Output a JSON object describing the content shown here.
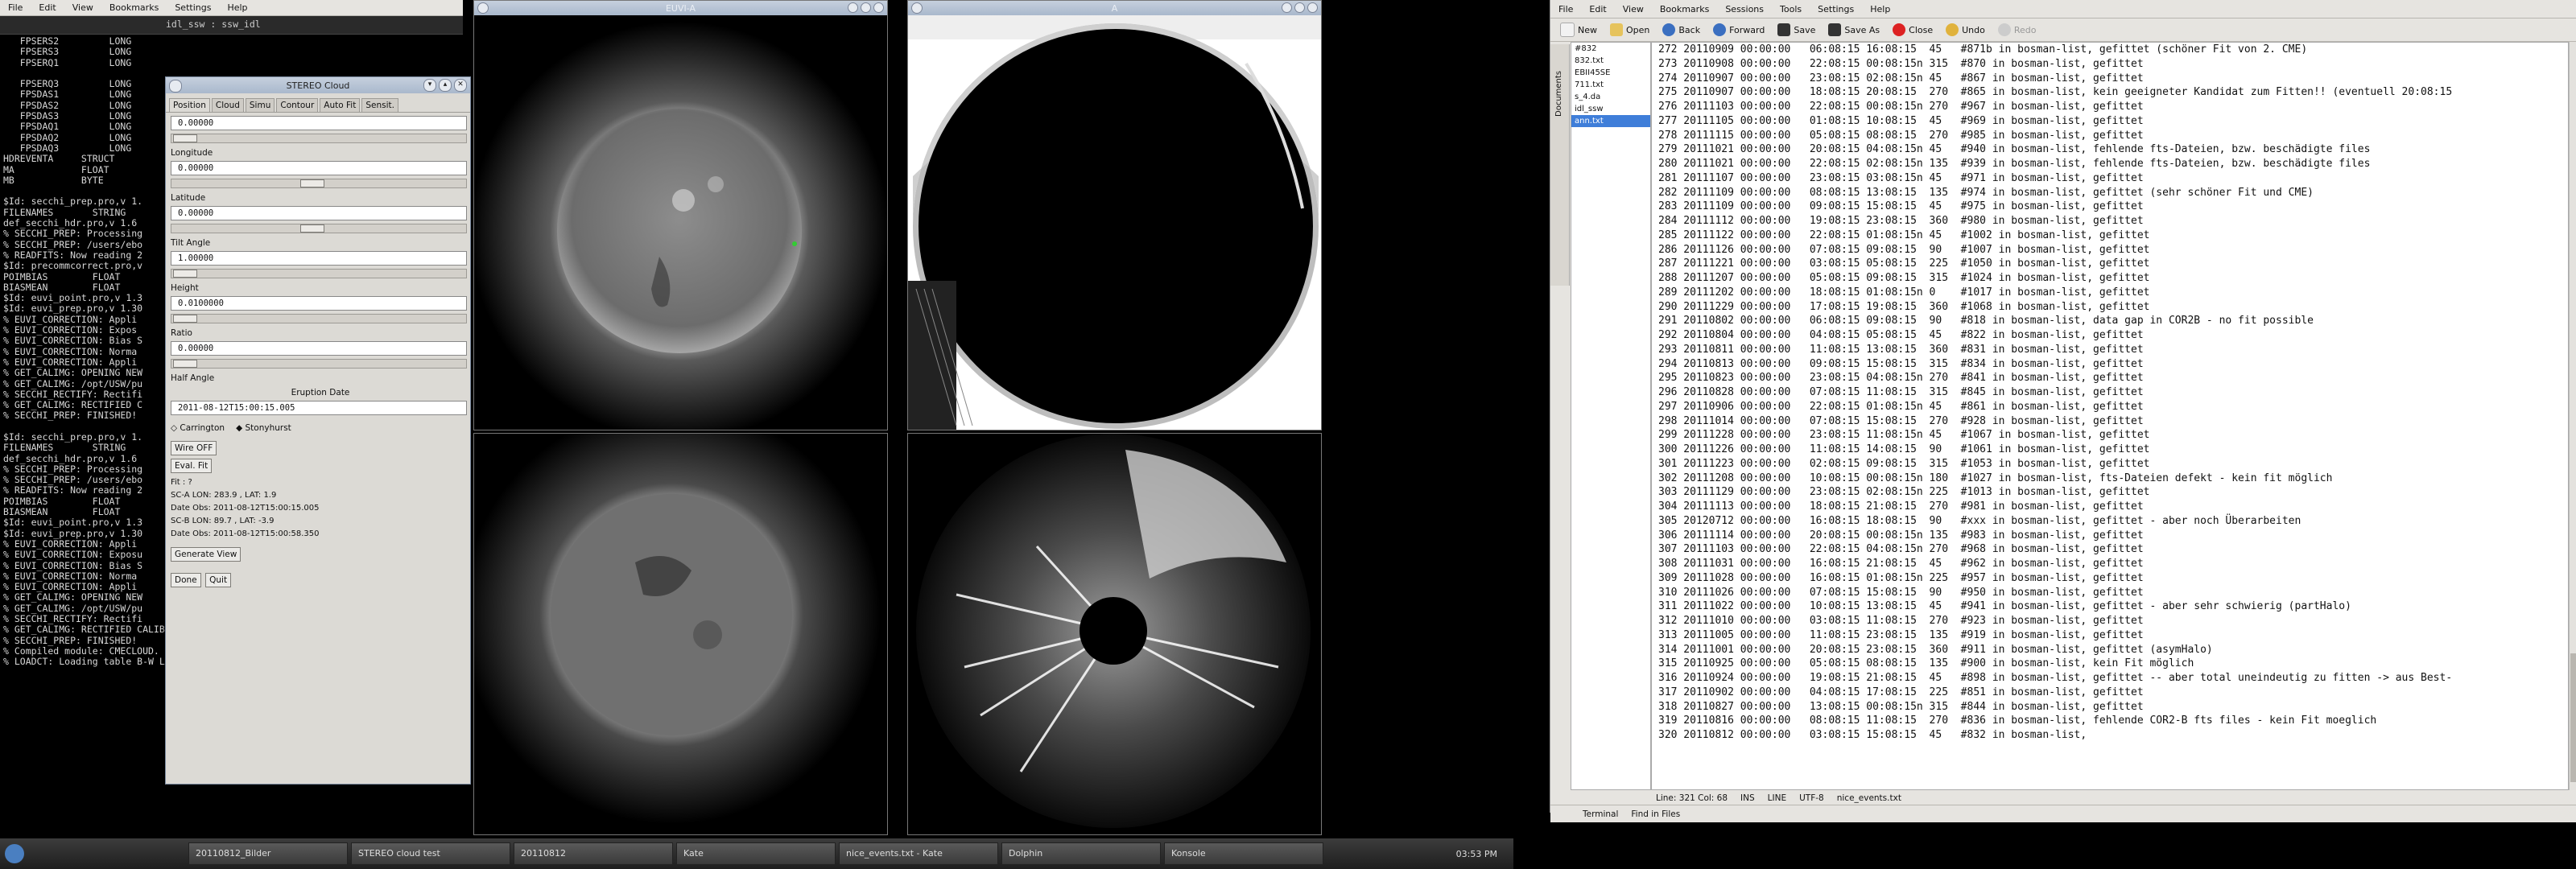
{
  "left_menu": [
    "File",
    "Edit",
    "View",
    "Bookmarks",
    "Settings",
    "Help"
  ],
  "terminal": {
    "tab_title": "idl_ssw : ssw_idl",
    "lines": [
      "   FPSERS2         LONG",
      "   FPSERS3         LONG",
      "   FPSERQ1         LONG",
      "",
      "   FPSERQ3         LONG",
      "   FPSDAS1         LONG",
      "   FPSDAS2         LONG",
      "   FPSDAS3         LONG",
      "   FPSDAQ1         LONG",
      "   FPSDAQ2         LONG",
      "   FPSDAQ3         LONG",
      "HDREVENTA     STRUCT",
      "MA            FLOAT",
      "MB            BYTE",
      "",
      "$Id: secchi_prep.pro,v 1.",
      "FILENAMES       STRING",
      "def_secchi_hdr.pro,v 1.6",
      "% SECCHI_PREP: Processing",
      "% SECCHI_PREP: /users/ebo",
      "% READFITS: Now reading 2",
      "$Id: precommcorrect.pro,v",
      "POIMBIAS        FLOAT",
      "BIASMEAN        FLOAT",
      "$Id: euvi_point.pro,v 1.3",
      "$Id: euvi_prep.pro,v 1.30",
      "% EUVI_CORRECTION: Appli",
      "% EUVI_CORRECTION: Expos",
      "% EUVI_CORRECTION: Bias S",
      "% EUVI_CORRECTION: Norma",
      "% EUVI_CORRECTION: Appli",
      "% GET_CALIMG: OPENING NEW",
      "% GET_CALIMG: /opt/USW/pu",
      "% SECCHI_RECTIFY: Rectifi",
      "% GET_CALIMG: RECTIFIED C",
      "% SECCHI_PREP: FINISHED!",
      "",
      "$Id: secchi_prep.pro,v 1.",
      "FILENAMES       STRING",
      "def_secchi_hdr.pro,v 1.6",
      "% SECCHI_PREP: Processing",
      "% SECCHI_PREP: /users/ebo",
      "% READFITS: Now reading 2",
      "POIMBIAS        FLOAT",
      "BIASMEAN        FLOAT",
      "$Id: euvi_point.pro,v 1.3",
      "$Id: euvi_prep.pro,v 1.30",
      "% EUVI_CORRECTION: Appli",
      "% EUVI_CORRECTION: Exposu",
      "% EUVI_CORRECTION: Bias S",
      "% EUVI_CORRECTION: Norma",
      "% EUVI_CORRECTION: Appli",
      "% GET_CALIMG: OPENING NEW",
      "% GET_CALIMG: /opt/USW/pu",
      "% SECCHI_RECTIFY: Rectifi",
      "% GET_CALIMG: RECTIFIED CALIBRATION IMAGE",
      "% SECCHI_PREP: FINISHED!",
      "% Compiled module: CMECLOUD.",
      "% LOADCT: Loading table B-W LINEAR"
    ]
  },
  "stereo": {
    "title": "STEREO Cloud",
    "tabs": [
      "Position",
      "Cloud",
      "Simu",
      "Contour",
      "Auto Fit",
      "Sensit."
    ],
    "fields": [
      {
        "value": "0.00000",
        "label": "Longitude"
      },
      {
        "value": "0.00000",
        "label": "Latitude"
      },
      {
        "value": "0.00000",
        "label": "Tilt Angle"
      },
      {
        "value": "1.00000",
        "label": "Height"
      },
      {
        "value": "0.0100000",
        "label": "Ratio"
      },
      {
        "value": "0.00000",
        "label": "Half Angle"
      }
    ],
    "eruption_label": "Eruption Date",
    "eruption_value": "2011-08-12T15:00:15.005",
    "radio_carrington": "Carrington",
    "radio_stonyhurst": "Stonyhurst",
    "wire_button": "Wire OFF",
    "eval_button": "Eval. Fit",
    "fit_text": "Fit : ?",
    "sca_lon": "SC-A LON:  283.9 , LAT:  1.9",
    "date_obs_a": "Date Obs: 2011-08-12T15:00:15.005",
    "scb_lon": "SC-B LON:  89.7 , LAT:  -3.9",
    "date_obs_b": "Date Obs: 2011-08-12T15:00:58.350",
    "generate_button": "Generate View",
    "done_button": "Done",
    "quit_button": "Quit"
  },
  "image_windows": [
    {
      "title": "EUVI-A"
    },
    {
      "title": "A"
    },
    {
      "title": ""
    },
    {
      "title": ""
    }
  ],
  "taskbar": {
    "tasks": [
      "20110812_Bilder",
      "STEREO cloud test",
      "20110812",
      "Kate",
      "nice_events.txt - Kate",
      "Dolphin",
      "Konsole"
    ],
    "clock": "03:53 PM"
  },
  "kate": {
    "title": "nice_events.txt – Kate",
    "menu": [
      "File",
      "Edit",
      "View",
      "Bookmarks",
      "Sessions",
      "Tools",
      "Settings",
      "Help"
    ],
    "toolbar": [
      "New",
      "Open",
      "Back",
      "Forward",
      "Save",
      "Save As",
      "Close",
      "Undo",
      "Redo"
    ],
    "documents": [
      "#832",
      "832.txt",
      "EBII45SE",
      "711.txt",
      "s_4.da",
      "idl_ssw",
      "ann.txt"
    ],
    "sidebar_label": "Documents",
    "lines": [
      "272 20110909 00:00:00   06:08:15 16:08:15  45   #871b in bosman-list, gefittet (schöner Fit von 2. CME)",
      "273 20110908 00:00:00   22:08:15 00:08:15n 315  #870 in bosman-list, gefittet",
      "274 20110907 00:00:00   23:08:15 02:08:15n 45   #867 in bosman-list, gefittet",
      "275 20110907 00:00:00   18:08:15 20:08:15  270  #865 in bosman-list, kein geeigneter Kandidat zum Fitten!! (eventuell 20:08:15",
      "276 20111103 00:00:00   22:08:15 00:08:15n 270  #967 in bosman-list, gefittet",
      "277 20111105 00:00:00   01:08:15 10:08:15  45   #969 in bosman-list, gefittet",
      "278 20111115 00:00:00   05:08:15 08:08:15  270  #985 in bosman-list, gefittet",
      "279 20111021 00:00:00   20:08:15 04:08:15n 45   #940 in bosman-list, fehlende fts-Dateien, bzw. beschädigte files",
      "280 20111021 00:00:00   22:08:15 02:08:15n 135  #939 in bosman-list, fehlende fts-Dateien, bzw. beschädigte files",
      "281 20111107 00:00:00   23:08:15 03:08:15n 45   #971 in bosman-list, gefittet",
      "282 20111109 00:00:00   08:08:15 13:08:15  135  #974 in bosman-list, gefittet (sehr schöner Fit und CME)",
      "283 20111109 00:00:00   09:08:15 15:08:15  45   #975 in bosman-list, gefittet",
      "284 20111112 00:00:00   19:08:15 23:08:15  360  #980 in bosman-list, gefittet",
      "285 20111122 00:00:00   22:08:15 01:08:15n 45   #1002 in bosman-list, gefittet",
      "286 20111126 00:00:00   07:08:15 09:08:15  90   #1007 in bosman-list, gefittet",
      "287 20111221 00:00:00   03:08:15 05:08:15  225  #1050 in bosman-list, gefittet",
      "288 20111207 00:00:00   05:08:15 09:08:15  315  #1024 in bosman-list, gefittet",
      "289 20111202 00:00:00   18:08:15 01:08:15n 0    #1017 in bosman-list, gefittet",
      "290 20111229 00:00:00   17:08:15 19:08:15  360  #1068 in bosman-list, gefittet",
      "291 20110802 00:00:00   06:08:15 09:08:15  90   #818 in bosman-list, data gap in COR2B - no fit possible",
      "292 20110804 00:00:00   04:08:15 05:08:15  45   #822 in bosman-list, gefittet",
      "293 20110811 00:00:00   11:08:15 13:08:15  360  #831 in bosman-list, gefittet",
      "294 20110813 00:00:00   09:08:15 15:08:15  315  #834 in bosman-list, gefittet",
      "295 20110823 00:00:00   23:08:15 04:08:15n 270  #841 in bosman-list, gefittet",
      "296 20110828 00:00:00   07:08:15 11:08:15  315  #845 in bosman-list, gefittet",
      "297 20110906 00:00:00   22:08:15 01:08:15n 45   #861 in bosman-list, gefittet",
      "298 20111014 00:00:00   07:08:15 15:08:15  270  #928 in bosman-list, gefittet",
      "299 20111228 00:00:00   23:08:15 11:08:15n 45   #1067 in bosman-list, gefittet",
      "300 20111226 00:00:00   11:08:15 14:08:15  90   #1061 in bosman-list, gefittet",
      "301 20111223 00:00:00   02:08:15 09:08:15  315  #1053 in bosman-list, gefittet",
      "302 20111208 00:00:00   10:08:15 00:08:15n 180  #1027 in bosman-list, fts-Dateien defekt - kein fit möglich",
      "303 20111129 00:00:00   23:08:15 02:08:15n 225  #1013 in bosman-list, gefittet",
      "304 20111113 00:00:00   18:08:15 21:08:15  270  #981 in bosman-list, gefittet",
      "305 20120712 00:00:00   16:08:15 18:08:15  90   #xxx in bosman-list, gefittet - aber noch Überarbeiten",
      "306 20111114 00:00:00   20:08:15 00:08:15n 135  #983 in bosman-list, gefittet",
      "307 20111103 00:00:00   22:08:15 04:08:15n 270  #968 in bosman-list, gefittet",
      "308 20111031 00:00:00   16:08:15 21:08:15  45   #962 in bosman-list, gefittet",
      "309 20111028 00:00:00   16:08:15 01:08:15n 225  #957 in bosman-list, gefittet",
      "310 20111026 00:00:00   07:08:15 15:08:15  90   #950 in bosman-list, gefittet",
      "311 20111022 00:00:00   10:08:15 13:08:15  45   #941 in bosman-list, gefittet - aber sehr schwierig (partHalo)",
      "312 20111010 00:00:00   03:08:15 11:08:15  270  #923 in bosman-list, gefittet",
      "313 20111005 00:00:00   11:08:15 23:08:15  135  #919 in bosman-list, gefittet",
      "314 20111001 00:00:00   20:08:15 23:08:15  360  #911 in bosman-list, gefittet (asymHalo)",
      "315 20110925 00:00:00   05:08:15 08:08:15  135  #900 in bosman-list, kein Fit möglich",
      "316 20110924 00:00:00   19:08:15 21:08:15  45   #898 in bosman-list, gefittet -- aber total uneindeutig zu fitten -> aus Best-",
      "317 20110902 00:00:00   04:08:15 17:08:15  225  #851 in bosman-list, gefittet",
      "318 20110827 00:00:00   13:08:15 00:08:15n 315  #844 in bosman-list, gefittet",
      "319 20110816 00:00:00   08:08:15 11:08:15  270  #836 in bosman-list, fehlende COR2-B fts files - kein Fit moeglich",
      "320 20110812 00:00:00   03:08:15 15:08:15  45   #832 in bosman-list,"
    ],
    "status": {
      "pos": "Line: 321 Col: 68",
      "ins": "INS",
      "mode": "LINE",
      "enc": "UTF-8",
      "file": "nice_events.txt"
    },
    "bottom": [
      "Terminal",
      "Find in Files"
    ]
  }
}
